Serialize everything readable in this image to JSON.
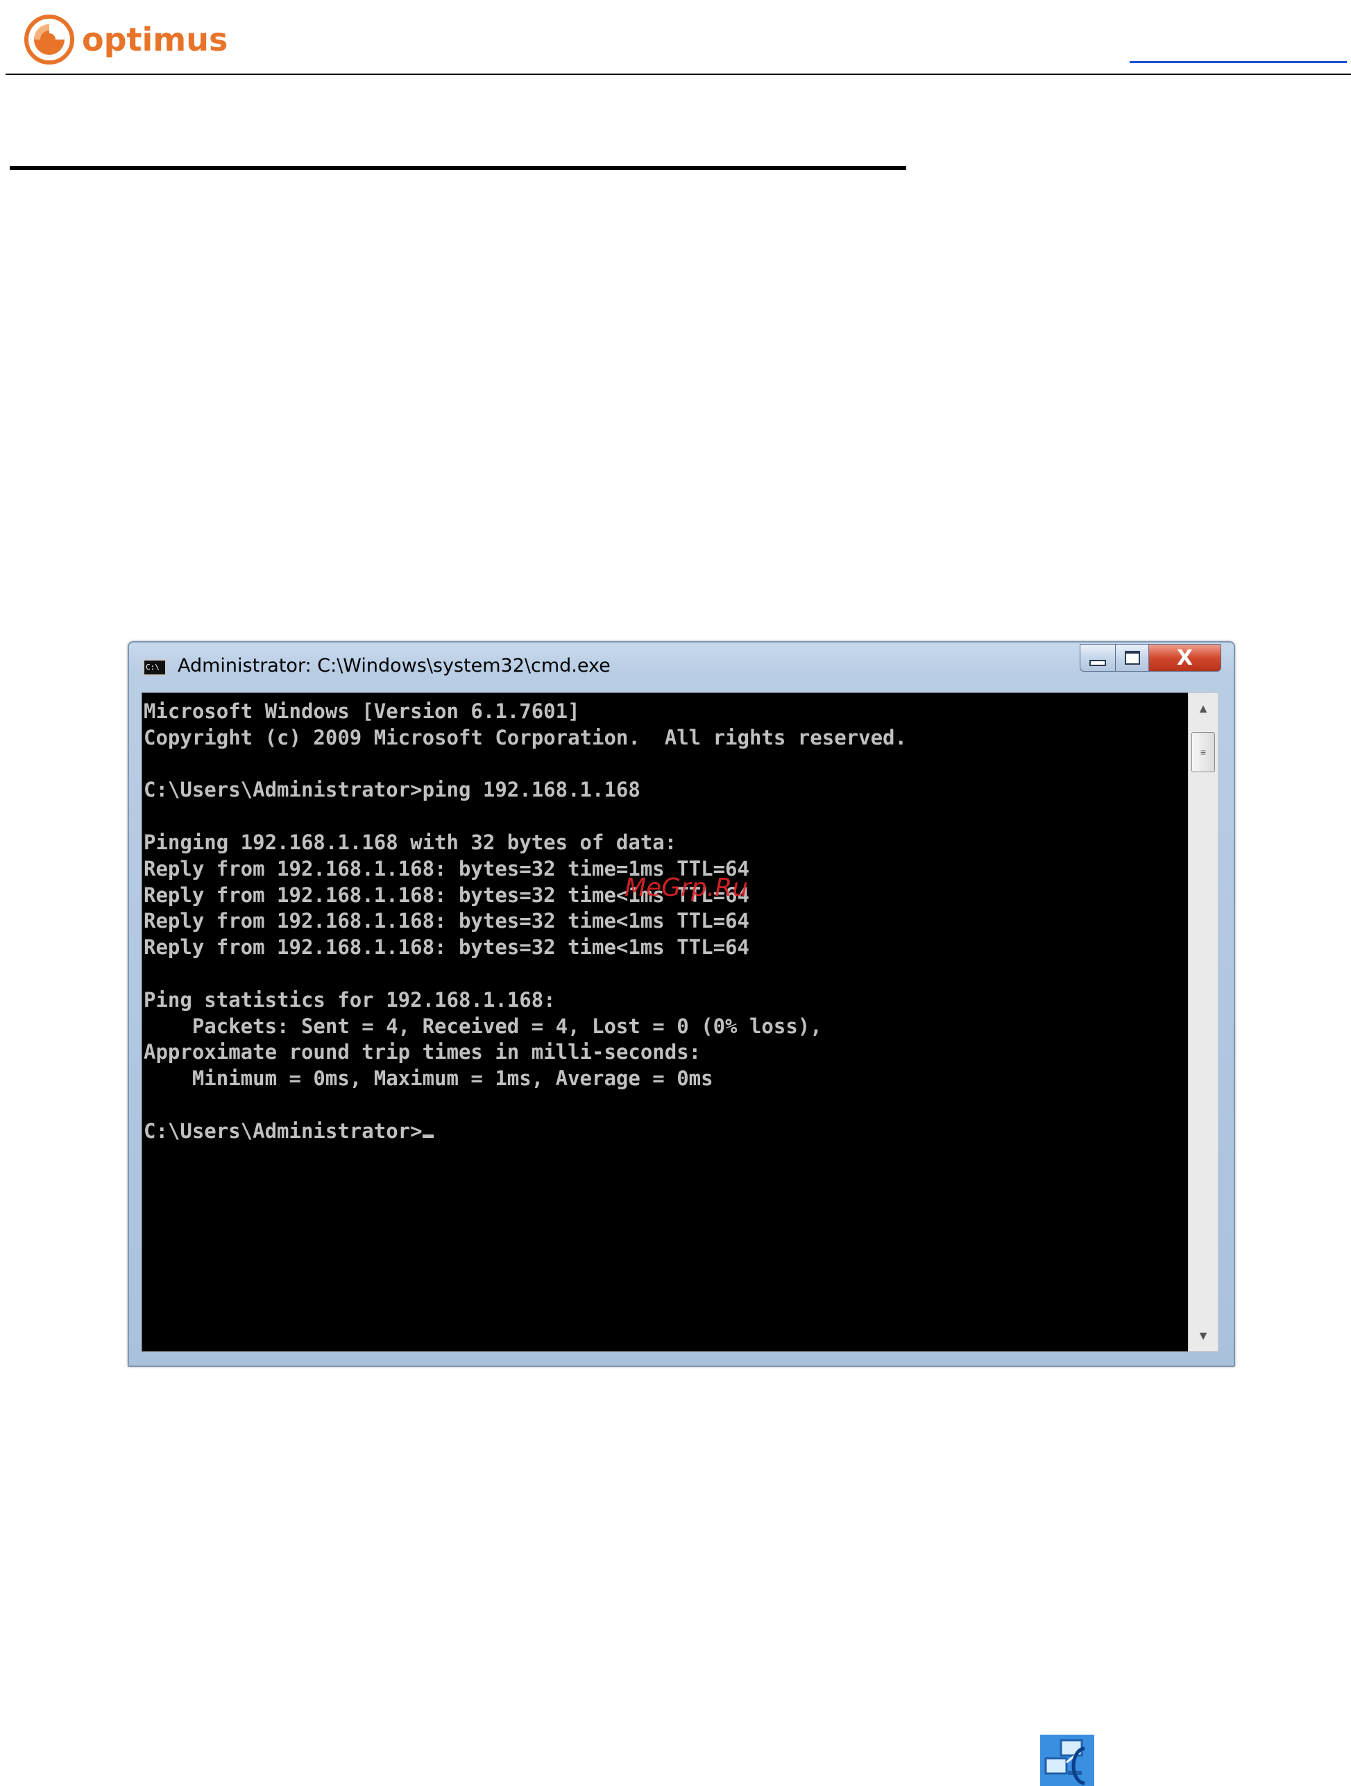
{
  "header": {
    "brand": "optimus"
  },
  "colors": {
    "brand_orange": "#e8742a",
    "console_bg": "#000000",
    "console_text": "#c0c0c0",
    "watermark_red": "#e1242b",
    "link_blue": "#1a4fd6"
  },
  "cmd_window": {
    "title": "Administrator: C:\\Windows\\system32\\cmd.exe",
    "icon_label": "C:\\",
    "close_label": "X",
    "console_lines": [
      "Microsoft Windows [Version 6.1.7601]",
      "Copyright (c) 2009 Microsoft Corporation.  All rights reserved.",
      "",
      "C:\\Users\\Administrator>ping 192.168.1.168",
      "",
      "Pinging 192.168.1.168 with 32 bytes of data:",
      "Reply from 192.168.1.168: bytes=32 time=1ms TTL=64",
      "Reply from 192.168.1.168: bytes=32 time<1ms TTL=64",
      "Reply from 192.168.1.168: bytes=32 time<1ms TTL=64",
      "Reply from 192.168.1.168: bytes=32 time<1ms TTL=64",
      "",
      "Ping statistics for 192.168.1.168:",
      "    Packets: Sent = 4, Received = 4, Lost = 0 (0% loss),",
      "Approximate round trip times in milli-seconds:",
      "    Minimum = 0ms, Maximum = 1ms, Average = 0ms",
      "",
      "C:\\Users\\Administrator>"
    ],
    "watermark": "MeGrp.Ru"
  },
  "icons": {
    "logo": "optimus-logo-icon",
    "title_icon": "cmd-icon",
    "minimize": "minimize-icon",
    "maximize": "maximize-icon",
    "close": "close-icon",
    "scroll_up": "scroll-up-icon",
    "scroll_down": "scroll-down-icon",
    "tray_network": "network-tray-icon"
  }
}
